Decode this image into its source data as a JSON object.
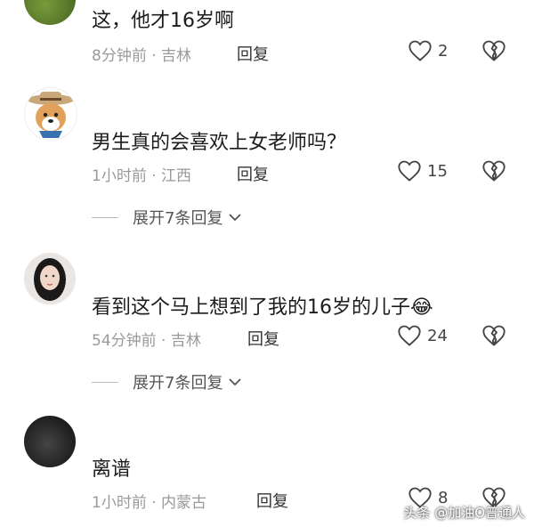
{
  "comments": [
    {
      "text": "这，他才16岁啊",
      "time": "8分钟前",
      "location": "吉林",
      "reply": "回复",
      "likes": "2"
    },
    {
      "text": "男生真的会喜欢上女老师吗？",
      "time": "1小时前",
      "location": "江西",
      "reply": "回复",
      "likes": "15",
      "expand": "展开7条回复"
    },
    {
      "text": "看到这个马上想到了我的16岁的儿子",
      "emoji": "😂",
      "time": "54分钟前",
      "location": "吉林",
      "reply": "回复",
      "likes": "24",
      "expand": "展开7条回复"
    },
    {
      "text": "离谱",
      "time": "1小时前",
      "location": "内蒙古",
      "reply": "回复",
      "likes": "8"
    }
  ],
  "meta_separator": "·",
  "watermark": "头条 @加油O普通人",
  "colors": {
    "meta": "#9a9a9a",
    "text": "#1c1c1c",
    "background": "#ffffff"
  },
  "icons": {
    "like": "heart-outline-icon",
    "dislike": "broken-heart-icon",
    "expand": "chevron-down-icon"
  }
}
